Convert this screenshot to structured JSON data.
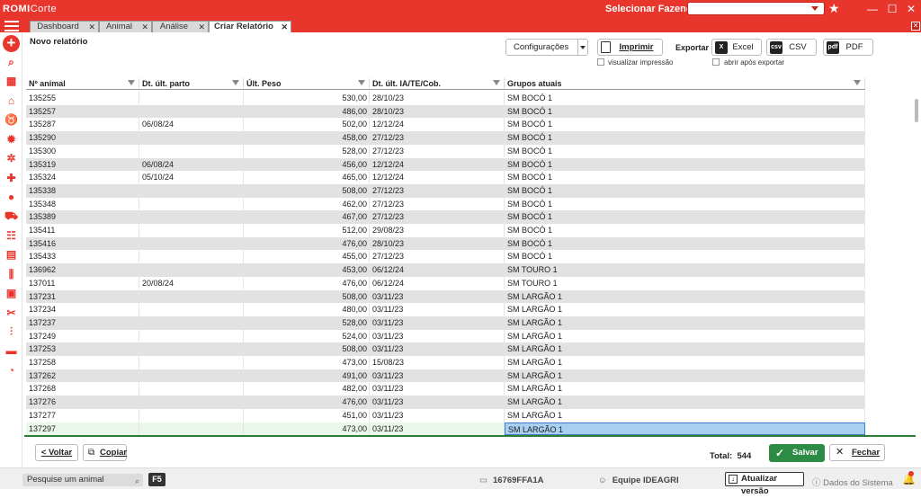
{
  "app": {
    "logo_main": "ROMI",
    "logo_sub": "Corte",
    "farm_selector_label": "Selecionar Fazenda",
    "farm_selector_value": ""
  },
  "tabs": [
    {
      "label": "Dashboard"
    },
    {
      "label": "Animal"
    },
    {
      "label": "Análise"
    },
    {
      "label": "Criar Relatório"
    }
  ],
  "report": {
    "title": "Novo relatório",
    "config_label": "Configurações",
    "print_label": "Imprimir",
    "view_print_label": "visualizar impressão",
    "export_label": "Exportar",
    "export_excel": "Excel",
    "export_csv": "CSV",
    "export_pdf": "PDF",
    "open_after_export": "abrir após exportar"
  },
  "table": {
    "columns": [
      "Nº animal",
      "Dt. últ. parto",
      "Últ. Peso",
      "Dt. últ. IA/TE/Cob.",
      "Grupos atuais"
    ],
    "rows": [
      [
        "135255",
        "",
        "530,00",
        "28/10/23",
        "SM BOCÓ 1"
      ],
      [
        "135257",
        "",
        "486,00",
        "28/10/23",
        "SM BOCÓ 1"
      ],
      [
        "135287",
        "06/08/24",
        "502,00",
        "12/12/24",
        "SM BOCÓ 1"
      ],
      [
        "135290",
        "",
        "458,00",
        "27/12/23",
        "SM BOCÓ 1"
      ],
      [
        "135300",
        "",
        "528,00",
        "27/12/23",
        "SM BOCÓ 1"
      ],
      [
        "135319",
        "06/08/24",
        "456,00",
        "12/12/24",
        "SM BOCÓ 1"
      ],
      [
        "135324",
        "05/10/24",
        "465,00",
        "12/12/24",
        "SM BOCÓ 1"
      ],
      [
        "135338",
        "",
        "508,00",
        "27/12/23",
        "SM BOCÓ 1"
      ],
      [
        "135348",
        "",
        "462,00",
        "27/12/23",
        "SM BOCÓ 1"
      ],
      [
        "135389",
        "",
        "467,00",
        "27/12/23",
        "SM BOCÓ 1"
      ],
      [
        "135411",
        "",
        "512,00",
        "29/08/23",
        "SM BOCÓ 1"
      ],
      [
        "135416",
        "",
        "476,00",
        "28/10/23",
        "SM BOCÓ 1"
      ],
      [
        "135433",
        "",
        "455,00",
        "27/12/23",
        "SM BOCÓ 1"
      ],
      [
        "136962",
        "",
        "453,00",
        "06/12/24",
        "SM TOURO 1"
      ],
      [
        "137011",
        "20/08/24",
        "476,00",
        "06/12/24",
        "SM TOURO 1"
      ],
      [
        "137231",
        "",
        "508,00",
        "03/11/23",
        "SM LARGÃO 1"
      ],
      [
        "137234",
        "",
        "480,00",
        "03/11/23",
        "SM LARGÃO 1"
      ],
      [
        "137237",
        "",
        "528,00",
        "03/11/23",
        "SM LARGÃO 1"
      ],
      [
        "137249",
        "",
        "524,00",
        "03/11/23",
        "SM LARGÃO 1"
      ],
      [
        "137253",
        "",
        "508,00",
        "03/11/23",
        "SM LARGÃO 1"
      ],
      [
        "137258",
        "",
        "473,00",
        "15/08/23",
        "SM LARGÃO 1"
      ],
      [
        "137262",
        "",
        "491,00",
        "03/11/23",
        "SM LARGÃO 1"
      ],
      [
        "137268",
        "",
        "482,00",
        "03/11/23",
        "SM LARGÃO 1"
      ],
      [
        "137276",
        "",
        "476,00",
        "03/11/23",
        "SM LARGÃO 1"
      ],
      [
        "137277",
        "",
        "451,00",
        "03/11/23",
        "SM LARGÃO 1"
      ],
      [
        "137297",
        "",
        "473,00",
        "03/11/23",
        "SM LARGÃO 1"
      ]
    ],
    "selected_row": 25
  },
  "footer": {
    "back_label": "< Voltar",
    "copy_label": "Copiar",
    "total_label": "Total:",
    "total_value": "544",
    "save_label": "Salvar",
    "close_label": "Fechar"
  },
  "status": {
    "search_placeholder": "Pesquise um animal",
    "f5_label": "F5",
    "device_id": "16769FFA1A",
    "team": "Equipe IDEAGRI",
    "update_label": "Atualizar versão",
    "system_data_label": "Dados do Sistema"
  },
  "colors": {
    "brand_red": "#e8362d",
    "save_green": "#2e8b45",
    "selection_blue": "#a8cef0"
  }
}
